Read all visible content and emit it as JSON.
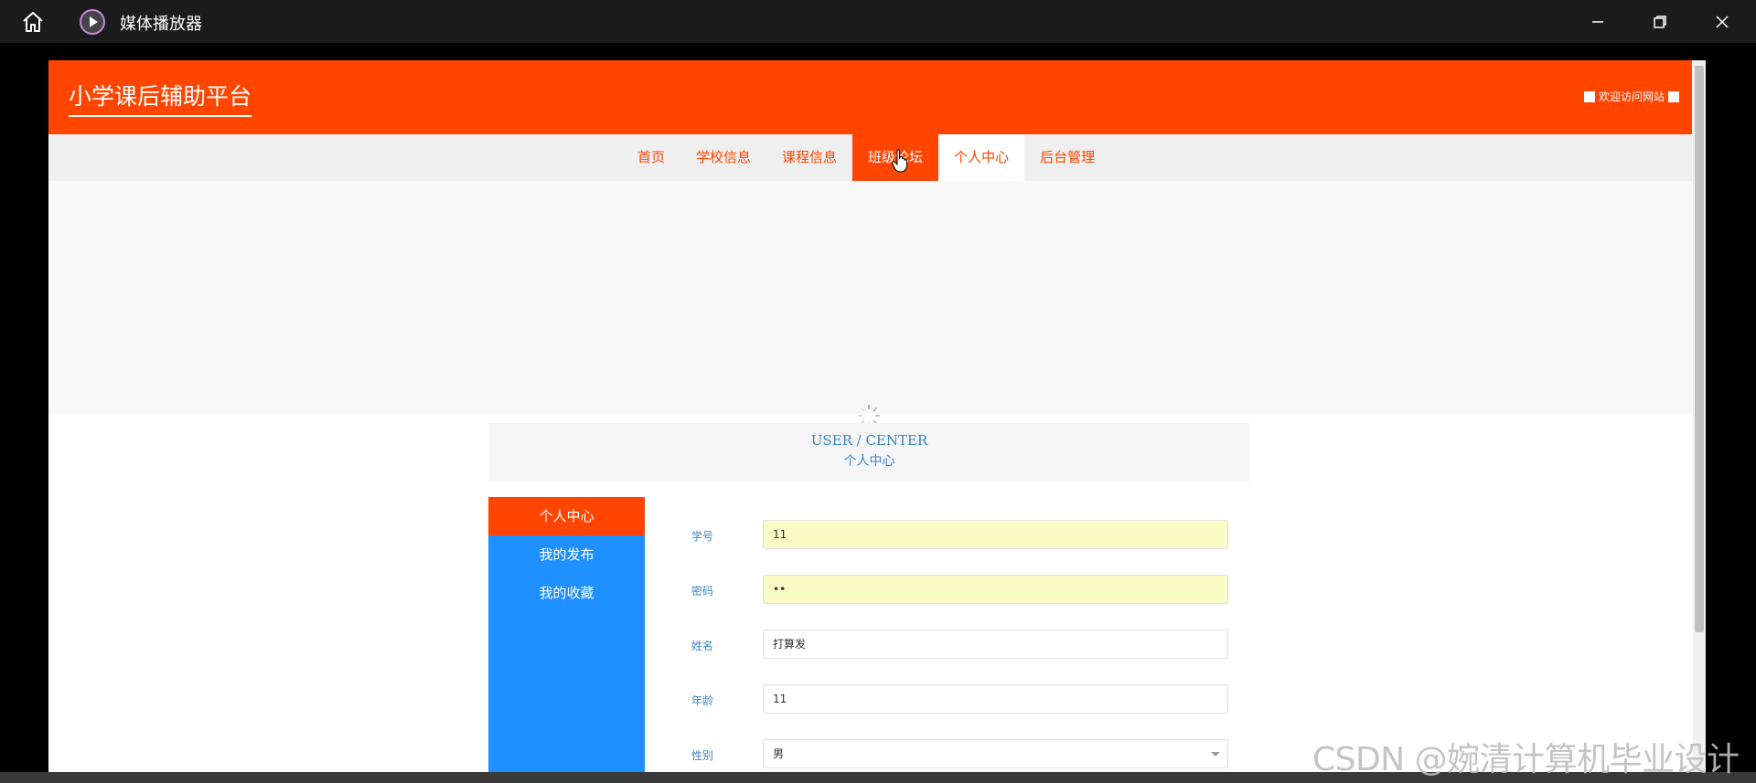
{
  "titlebar": {
    "app_title": "媒体播放器",
    "icons": [
      "home-icon",
      "media-player-icon",
      "minimize-icon",
      "maximize-icon",
      "close-icon"
    ]
  },
  "site": {
    "logo": "小学课后辅助平台",
    "welcome": "欢迎访问网站",
    "colors": {
      "primary": "#ff4500",
      "sidebar": "#1e90ff",
      "label": "#3a86c8"
    }
  },
  "nav": {
    "items": [
      {
        "label": "首页"
      },
      {
        "label": "学校信息"
      },
      {
        "label": "课程信息"
      },
      {
        "label": "班级论坛"
      },
      {
        "label": "个人中心"
      },
      {
        "label": "后台管理"
      }
    ],
    "hover_index": 3,
    "active_index": 4
  },
  "user_center": {
    "title_en": "USER / CENTER",
    "title_cn": "个人中心"
  },
  "side_menu": {
    "items": [
      {
        "label": "个人中心"
      },
      {
        "label": "我的发布"
      },
      {
        "label": "我的收藏"
      }
    ]
  },
  "form": {
    "student_id": {
      "label": "学号",
      "value": "11"
    },
    "password": {
      "label": "密码",
      "value": "••"
    },
    "name": {
      "label": "姓名",
      "value": "打算发"
    },
    "age": {
      "label": "年龄",
      "value": "11"
    },
    "gender": {
      "label": "性别",
      "value": "男"
    }
  },
  "watermark": "CSDN @婉清计算机毕业设计"
}
